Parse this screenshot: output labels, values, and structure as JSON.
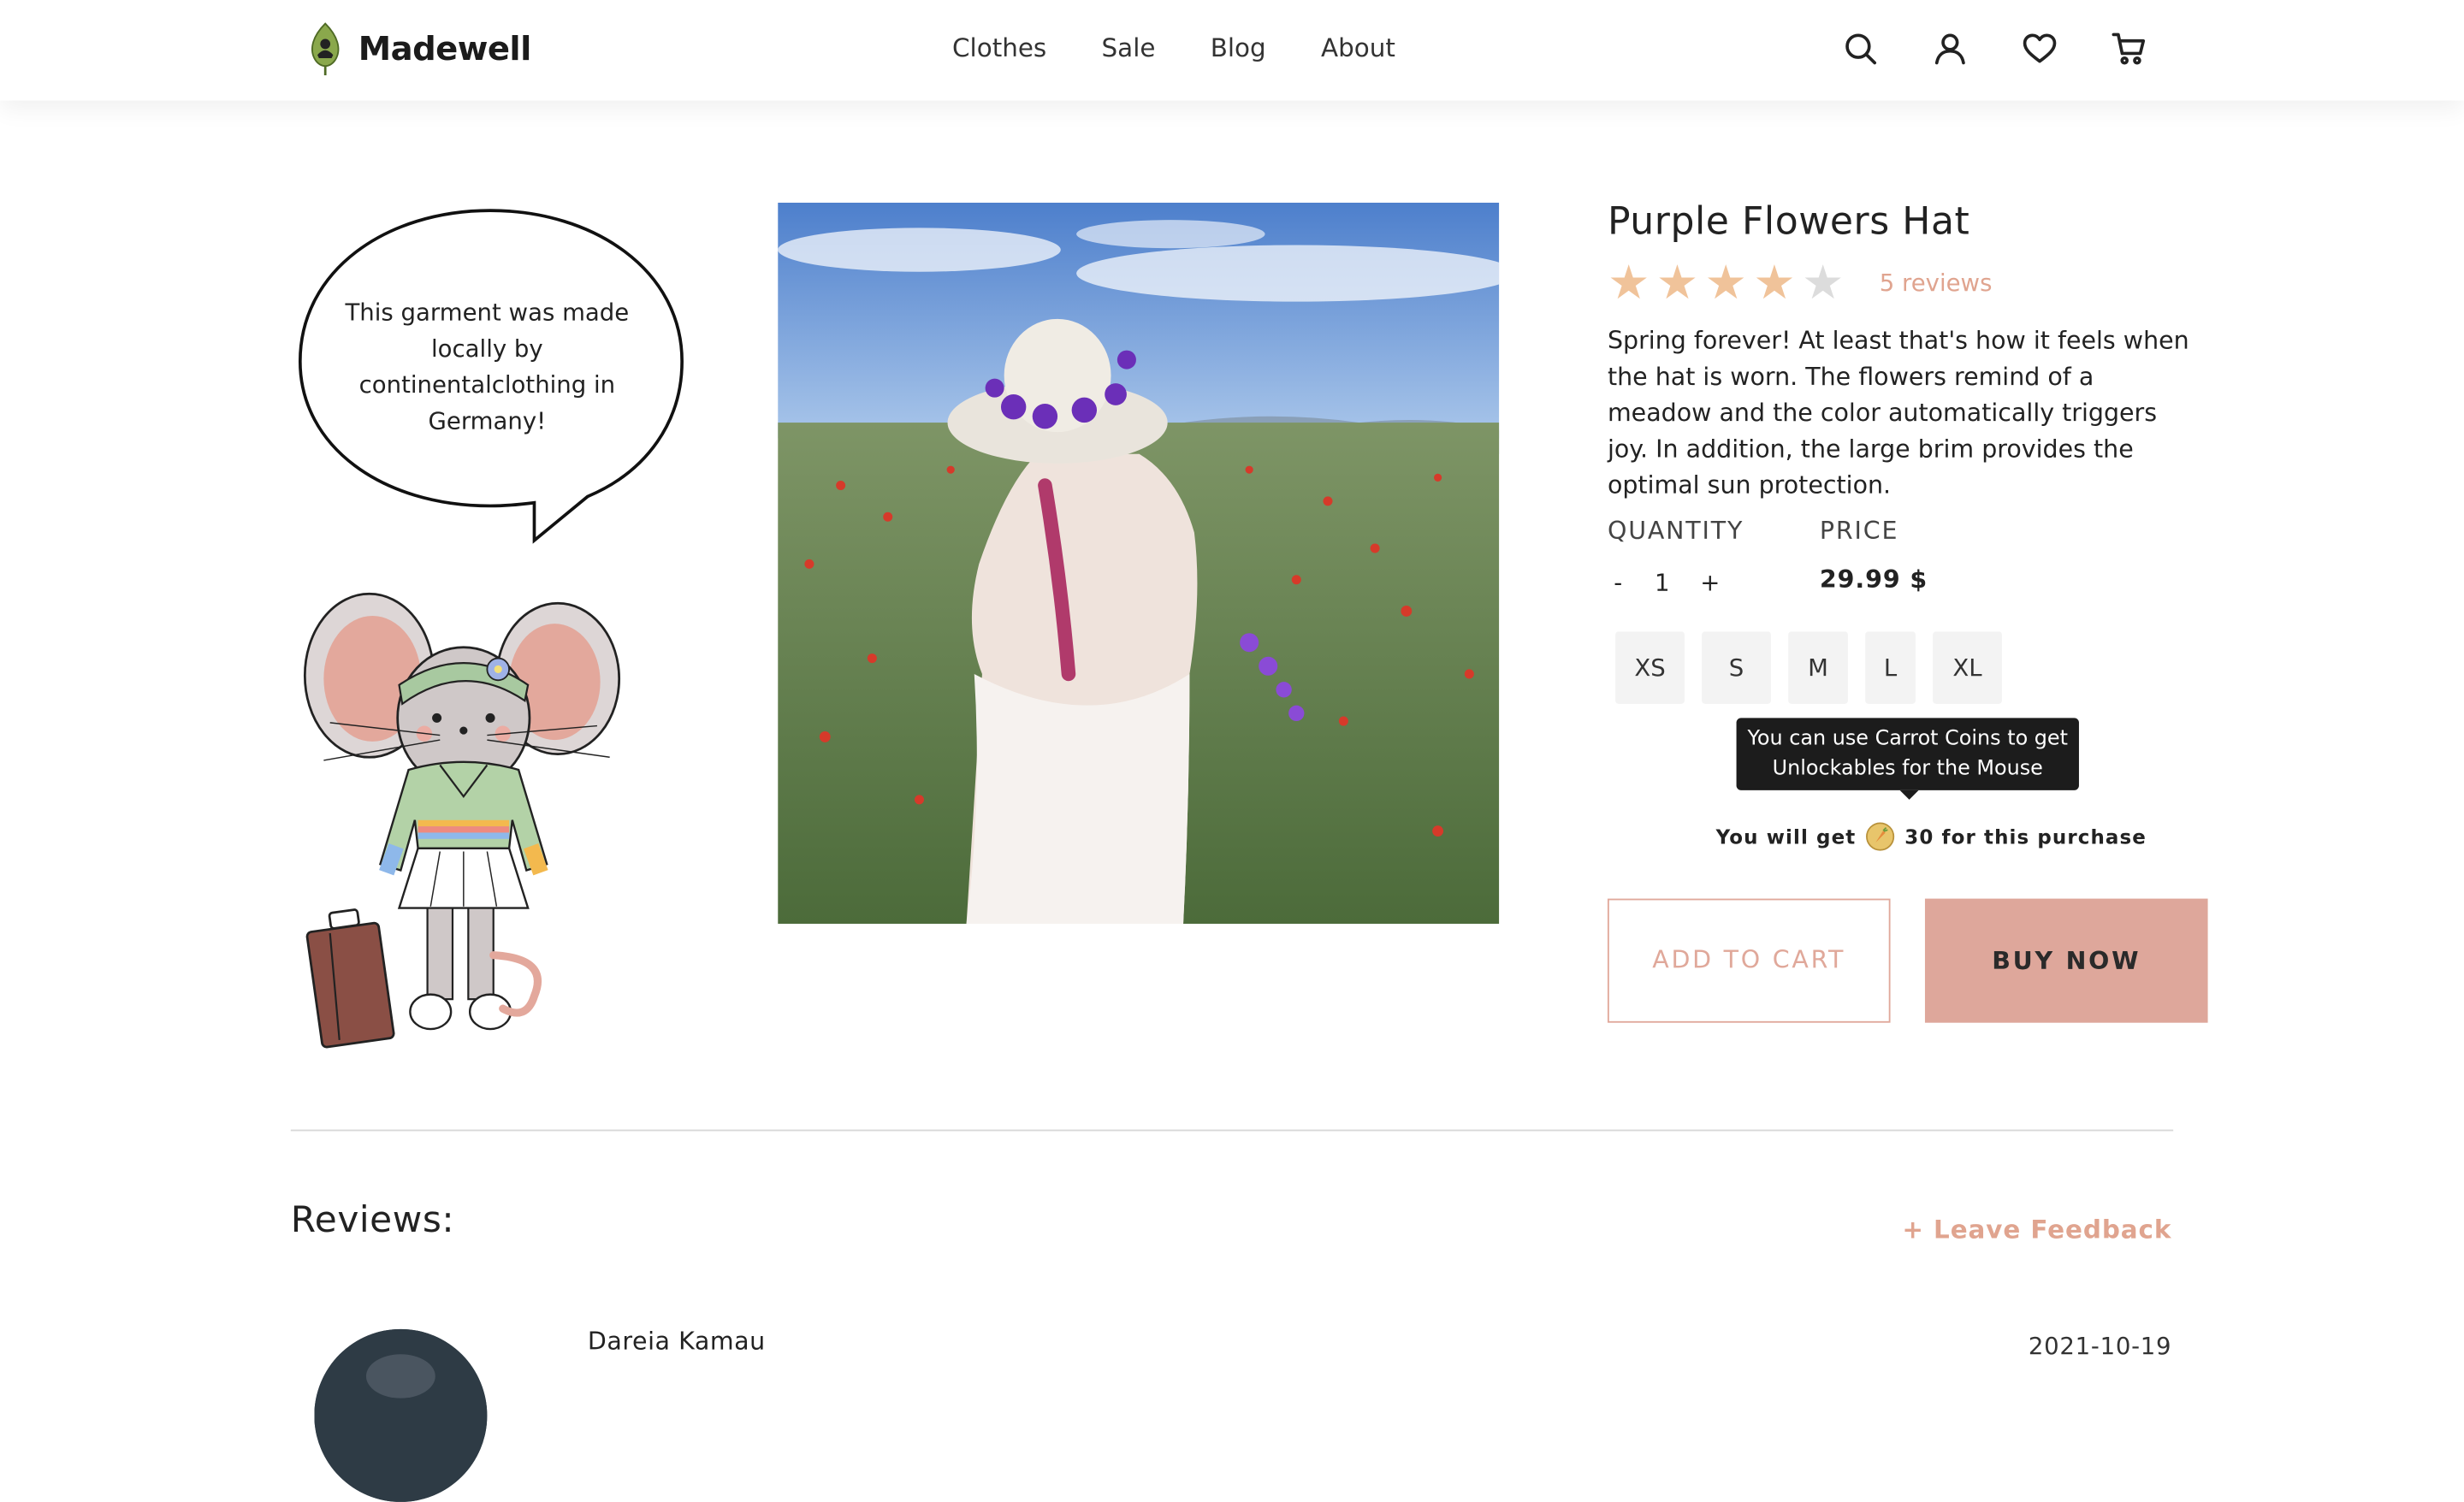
{
  "brand": {
    "name": "Madewell"
  },
  "nav": {
    "items": [
      "Clothes",
      "Sale",
      "Blog",
      "About"
    ]
  },
  "header_icons": [
    "search-icon",
    "user-icon",
    "heart-icon",
    "cart-icon"
  ],
  "speech_bubble": {
    "text": "This garment was made locally by continentalclothing in Germany!"
  },
  "product": {
    "title": "Purple Flowers Hat",
    "rating": 4,
    "rating_max": 5,
    "reviews_label": "5 reviews",
    "description": "Spring forever! At least that's how it feels when the hat is worn. The flowers remind of a meadow and the color automatically triggers joy. In addition, the large brim provides the optimal sun protection.",
    "quantity_label": "QUANTITY",
    "quantity_minus": "-",
    "quantity_value": "1",
    "quantity_plus": "+",
    "price_label": "PRICE",
    "price_value": "29.99 $",
    "sizes": [
      "XS",
      "S",
      "M",
      "L",
      "XL"
    ]
  },
  "tooltip": {
    "text": "You can use Carrot Coins to get Unlockables for the Mouse"
  },
  "coins": {
    "prefix": "You will get",
    "suffix": "30 for this purchase"
  },
  "buttons": {
    "add_to_cart": "ADD TO CART",
    "buy_now": "BUY NOW"
  },
  "reviews": {
    "title": "Reviews:",
    "leave_feedback": "+ Leave Feedback",
    "items": [
      {
        "name": "Dareia Kamau",
        "date": "2021-10-19"
      }
    ]
  },
  "colors": {
    "accent": "#dea79b",
    "accent_text": "#e0a48f",
    "star": "#f0c39a",
    "tooltip_bg": "#1c1c1c"
  }
}
